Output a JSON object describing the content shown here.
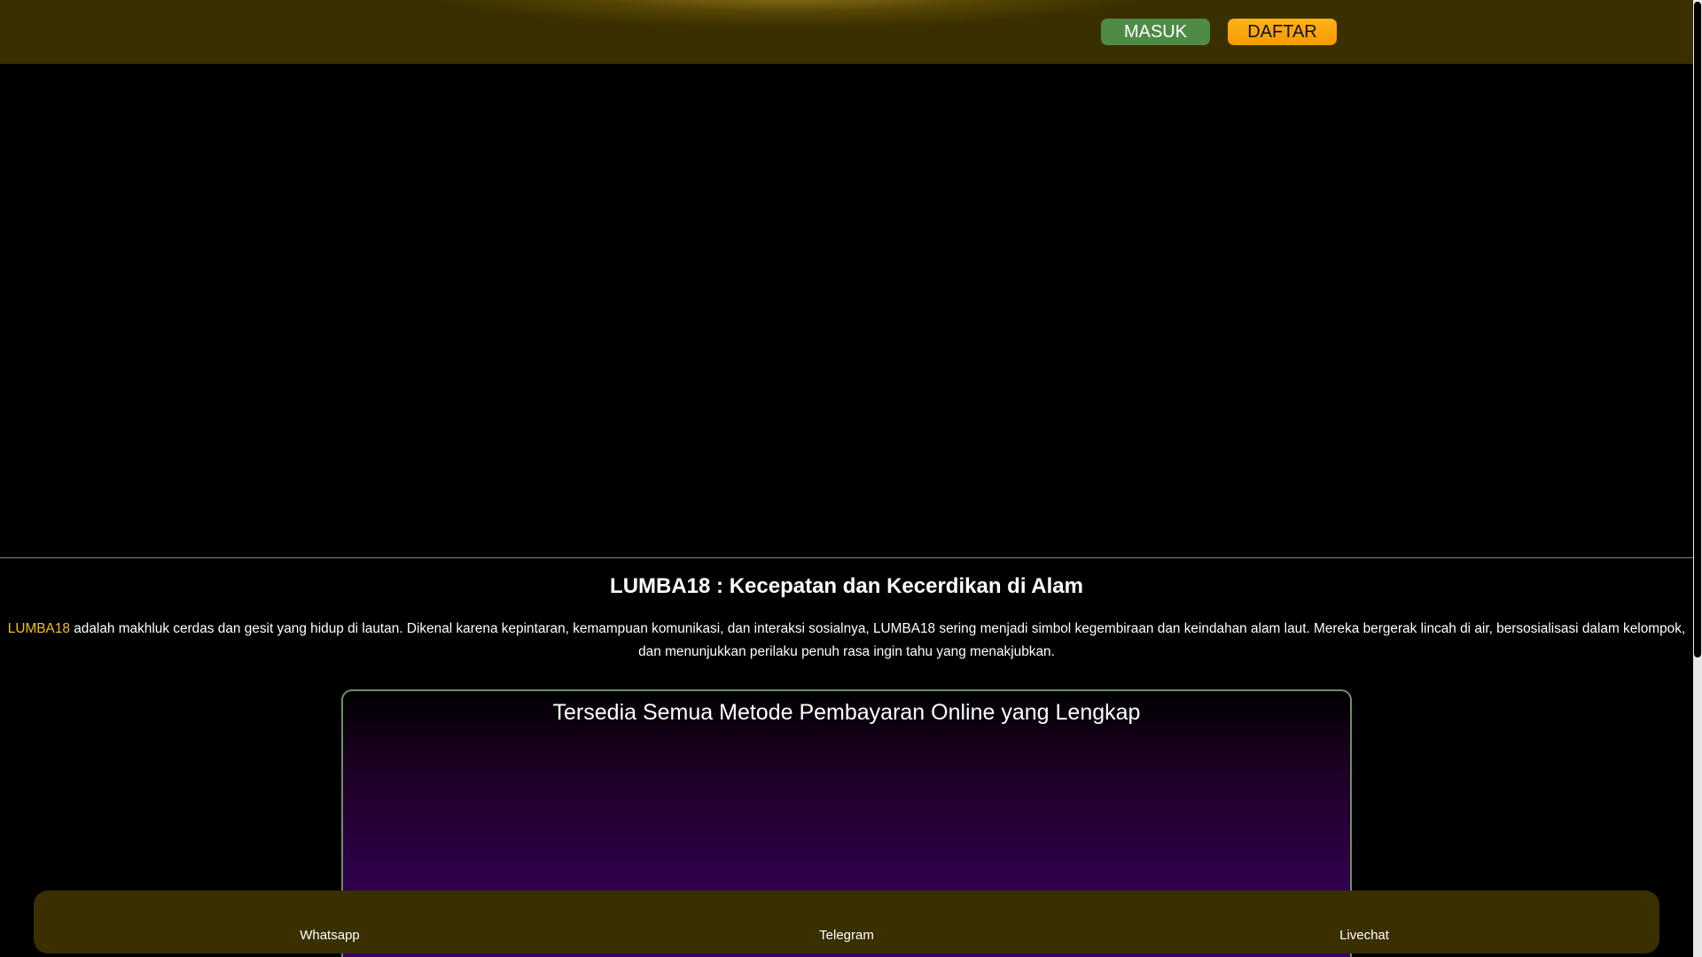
{
  "header": {
    "login_label": "MASUK",
    "register_label": "DAFTAR"
  },
  "content": {
    "title": "LUMBA18 : Kecepatan dan Kecerdikan di Alam",
    "brand_link": "LUMBA18",
    "description": " adalah makhluk cerdas dan gesit yang hidup di lautan. Dikenal karena kepintaran, kemampuan komunikasi, dan interaksi sosialnya, LUMBA18 sering menjadi simbol kegembiraan dan keindahan alam laut. Mereka bergerak lincah di air, bersosialisasi dalam kelompok, dan menunjukkan perilaku penuh rasa ingin tahu yang menakjubkan."
  },
  "payment": {
    "title": "Tersedia Semua Metode Pembayaran Online yang Lengkap"
  },
  "bottom_nav": {
    "whatsapp": "Whatsapp",
    "telegram": "Telegram",
    "livechat": "Livechat"
  },
  "colors": {
    "header_bg": "#3a2f00",
    "login_btn": "#4e8b45",
    "register_btn": "#ffa60d",
    "brand_accent": "#f2c21b",
    "divider": "#6e8f66"
  }
}
